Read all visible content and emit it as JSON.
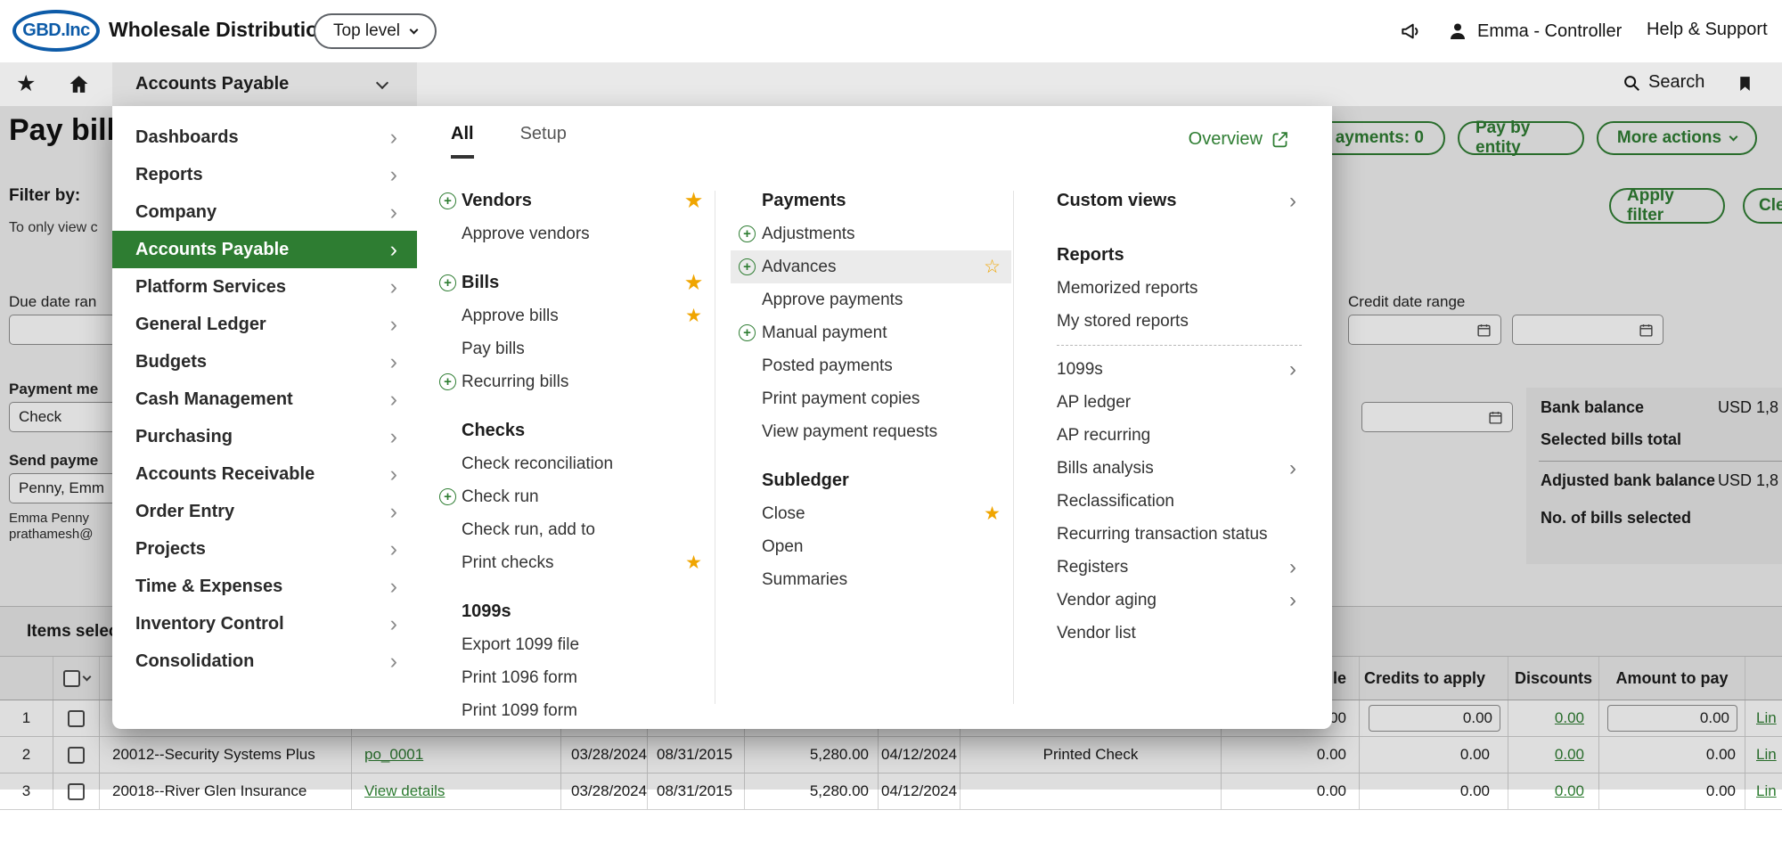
{
  "topbar": {
    "logo": "GBD.Inc",
    "title": "Wholesale Distribution",
    "entity": "Top level",
    "user": "Emma - Controller",
    "help": "Help & Support"
  },
  "navbar": {
    "module": "Accounts Payable",
    "search": "Search"
  },
  "menu": {
    "tabs": [
      {
        "label": "All"
      },
      {
        "label": "Setup"
      }
    ],
    "overview": "Overview",
    "sidebar": [
      {
        "label": "Dashboards"
      },
      {
        "label": "Reports"
      },
      {
        "label": "Company"
      },
      {
        "label": "Accounts Payable",
        "active": true
      },
      {
        "label": "Platform Services"
      },
      {
        "label": "General Ledger"
      },
      {
        "label": "Budgets"
      },
      {
        "label": "Cash Management"
      },
      {
        "label": "Purchasing"
      },
      {
        "label": "Accounts Receivable"
      },
      {
        "label": "Order Entry"
      },
      {
        "label": "Projects"
      },
      {
        "label": "Time & Expenses"
      },
      {
        "label": "Inventory Control"
      },
      {
        "label": "Consolidation"
      }
    ],
    "col1": [
      {
        "label": "Vendors",
        "type": "header",
        "plus": true,
        "star": "filled"
      },
      {
        "label": "Approve vendors",
        "type": "item"
      },
      {
        "label": "Bills",
        "type": "header",
        "plus": true,
        "star": "filled"
      },
      {
        "label": "Approve bills",
        "type": "item",
        "star": "filled"
      },
      {
        "label": "Pay bills",
        "type": "item"
      },
      {
        "label": "Recurring bills",
        "type": "item",
        "plus": true
      },
      {
        "label": "Checks",
        "type": "header"
      },
      {
        "label": "Check reconciliation",
        "type": "item"
      },
      {
        "label": "Check run",
        "type": "item",
        "plus": true
      },
      {
        "label": "Check run, add to",
        "type": "item"
      },
      {
        "label": "Print checks",
        "type": "item",
        "star": "filled"
      },
      {
        "label": "1099s",
        "type": "header"
      },
      {
        "label": "Export 1099 file",
        "type": "item"
      },
      {
        "label": "Print 1096 form",
        "type": "item"
      },
      {
        "label": "Print 1099 form",
        "type": "item"
      }
    ],
    "col2": [
      {
        "label": "Payments",
        "type": "header"
      },
      {
        "label": "Adjustments",
        "type": "item",
        "plus": true
      },
      {
        "label": "Advances",
        "type": "item",
        "plus": true,
        "star": "outline",
        "highlighted": true
      },
      {
        "label": "Approve payments",
        "type": "item"
      },
      {
        "label": "Manual payment",
        "type": "item",
        "plus": true
      },
      {
        "label": "Posted payments",
        "type": "item"
      },
      {
        "label": "Print payment copies",
        "type": "item"
      },
      {
        "label": "View payment requests",
        "type": "item"
      },
      {
        "label": "Subledger",
        "type": "header"
      },
      {
        "label": "Close",
        "type": "item",
        "star": "filled"
      },
      {
        "label": "Open",
        "type": "item"
      },
      {
        "label": "Summaries",
        "type": "item"
      }
    ],
    "col3": [
      {
        "label": "Custom views",
        "type": "header",
        "chevron": true
      },
      {
        "label": "Reports",
        "type": "header"
      },
      {
        "label": "Memorized reports",
        "type": "item"
      },
      {
        "label": "My stored reports",
        "type": "item"
      },
      {
        "label": "1099s",
        "type": "item",
        "chevron": true
      },
      {
        "label": "AP ledger",
        "type": "item"
      },
      {
        "label": "AP recurring",
        "type": "item"
      },
      {
        "label": "Bills analysis",
        "type": "item",
        "chevron": true
      },
      {
        "label": "Reclassification",
        "type": "item"
      },
      {
        "label": "Recurring transaction status",
        "type": "item"
      },
      {
        "label": "Registers",
        "type": "item",
        "chevron": true
      },
      {
        "label": "Vendor aging",
        "type": "item",
        "chevron": true
      },
      {
        "label": "Vendor list",
        "type": "item"
      }
    ]
  },
  "colors": {
    "accent_green": "#2e7d32",
    "star_gold": "#f0a500",
    "logo_blue": "#0d5ba8"
  },
  "page": {
    "title": "Pay bills",
    "actions": {
      "payments": "ayments: 0",
      "pay_by_entity": "Pay by entity",
      "more_actions": "More actions"
    },
    "filter": {
      "label": "Filter by:",
      "hint": "To only view c",
      "apply": "Apply filter",
      "clear": "Cle"
    },
    "fields": {
      "due_date_label": "Due date ran",
      "credit_date_label": "Credit date range",
      "payment_method_label": "Payment me",
      "payment_method_value": "Check",
      "send_payment_label": "Send payme",
      "send_payment_value": "Penny, Emm",
      "sender_name": "Emma Penny",
      "sender_email": "prathamesh@"
    },
    "summary": {
      "bank_balance_label": "Bank balance",
      "bank_balance_value": "USD 1,8",
      "selected_bills_label": "Selected bills total",
      "adjusted_balance_label": "Adjusted bank balance",
      "adjusted_balance_value": "USD 1,8",
      "bills_selected_label": "No. of bills selected"
    },
    "table": {
      "section": "Items select",
      "headers": {
        "payable": "le",
        "credits": "Credits to apply",
        "discounts": "Discounts",
        "amount": "Amount to pay"
      },
      "rows": [
        {
          "num": "1",
          "vendor": "",
          "doc": "",
          "date1": "",
          "date2": "",
          "amount": "",
          "date3": "",
          "method": "",
          "payable": "0.00",
          "credits": "0.00",
          "discounts": "0.00",
          "pay": "0.00",
          "line": "Lin"
        },
        {
          "num": "2",
          "vendor": "20012--Security Systems Plus",
          "doc": "po_0001",
          "date1": "03/28/2024",
          "date2": "08/31/2015",
          "amount": "5,280.00",
          "date3": "04/12/2024",
          "method": "Printed Check",
          "payable": "0.00",
          "credits": "0.00",
          "discounts": "0.00",
          "pay": "0.00",
          "line": "Lin"
        },
        {
          "num": "3",
          "vendor": "20018--River Glen Insurance",
          "doc": "View details",
          "date1": "03/28/2024",
          "date2": "08/31/2015",
          "amount": "5,280.00",
          "date3": "04/12/2024",
          "method": "",
          "payable": "0.00",
          "credits": "0.00",
          "discounts": "0.00",
          "pay": "0.00",
          "line": "Lin"
        }
      ]
    }
  }
}
